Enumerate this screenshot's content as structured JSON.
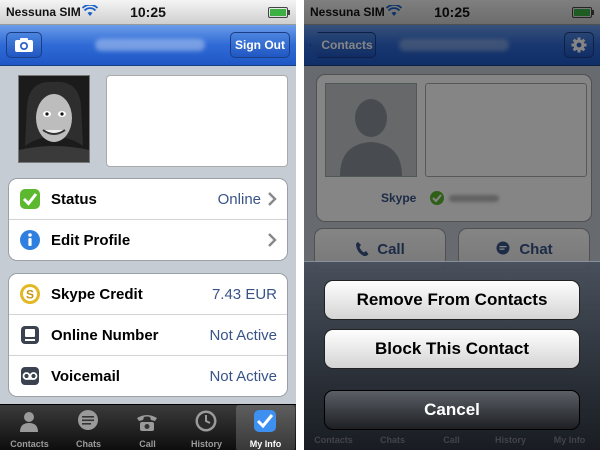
{
  "left_screen": {
    "status_bar": {
      "carrier": "Nessuna SIM",
      "time": "10:25"
    },
    "nav": {
      "camera_icon": "camera-icon",
      "sign_out": "Sign Out"
    },
    "group1": [
      {
        "label": "Status",
        "value": "Online",
        "icon": "status-check-icon"
      },
      {
        "label": "Edit Profile",
        "value": "",
        "icon": "info-icon"
      }
    ],
    "group2": [
      {
        "label": "Skype Credit",
        "value": "7.43 EUR",
        "icon": "skype-credit-icon"
      },
      {
        "label": "Online Number",
        "value": "Not Active",
        "icon": "online-number-icon"
      },
      {
        "label": "Voicemail",
        "value": "Not Active",
        "icon": "voicemail-icon"
      }
    ],
    "tabs": [
      {
        "label": "Contacts",
        "icon": "contacts-icon"
      },
      {
        "label": "Chats",
        "icon": "chats-icon"
      },
      {
        "label": "Call",
        "icon": "call-icon"
      },
      {
        "label": "History",
        "icon": "history-icon"
      },
      {
        "label": "My Info",
        "icon": "my-info-icon",
        "active": true
      }
    ]
  },
  "right_screen": {
    "status_bar": {
      "carrier": "Nessuna SIM",
      "time": "10:25"
    },
    "nav": {
      "back": "Contacts",
      "gear_icon": "gear-icon"
    },
    "card": {
      "skype_label": "Skype"
    },
    "actions": {
      "call": "Call",
      "chat": "Chat"
    },
    "sheet": {
      "remove": "Remove From Contacts",
      "block": "Block This Contact",
      "cancel": "Cancel"
    },
    "faded_tabs": [
      "Contacts",
      "Chats",
      "Call",
      "History",
      "My Info"
    ]
  },
  "colors": {
    "nav_blue": "#2f6ad6",
    "value_blue": "#385487",
    "online_green": "#3cb043"
  }
}
